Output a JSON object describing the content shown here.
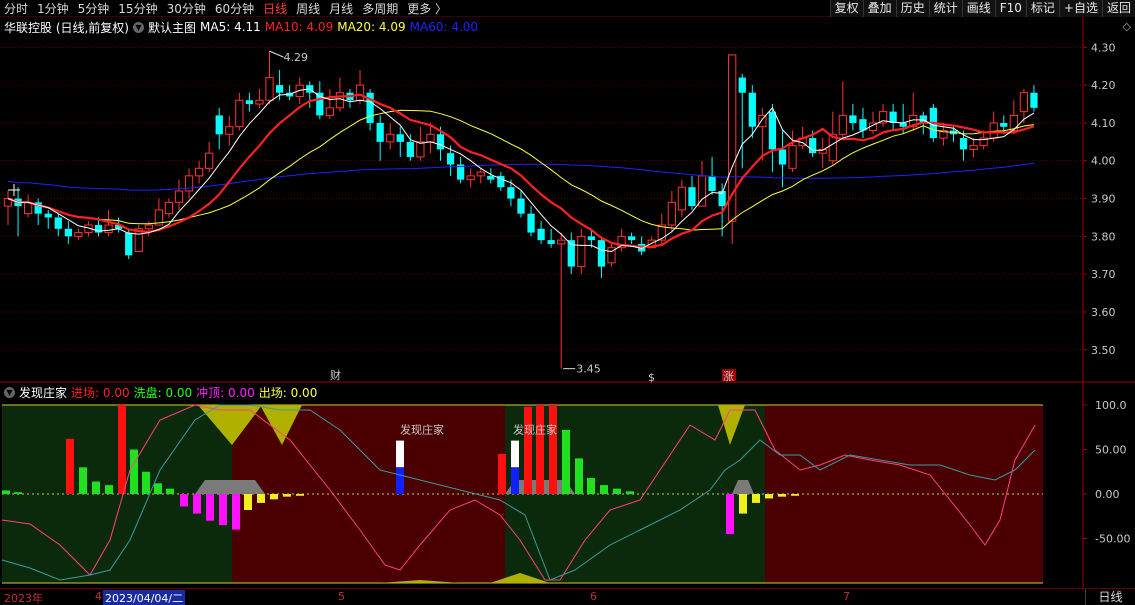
{
  "toolbar": {
    "period_tabs": [
      "分时",
      "1分钟",
      "5分钟",
      "15分钟",
      "30分钟",
      "60分钟",
      "日线",
      "周线",
      "月线",
      "多周期",
      "更多 〉"
    ],
    "active_period": "日线",
    "buttons": [
      "复权",
      "叠加",
      "历史",
      "统计",
      "画线",
      "F10",
      "标记",
      "+自选",
      "返回"
    ]
  },
  "main": {
    "title": "华联控股 (日线,前复权)",
    "template": "默认主图",
    "ma5": "MA5: 4.11",
    "ma10": "MA10: 4.09",
    "ma20": "MA20: 4.09",
    "ma60": "MA60: 4.00",
    "high_marker": "4.29",
    "low_marker": "3.45",
    "event_caiyi": "财",
    "event_s": "$",
    "event_zhang": "涨",
    "colors": {
      "up": "#ff3232",
      "down": "#00ffff",
      "ma5": "#ffffff",
      "ma10": "#ff2020",
      "ma20": "#ffff40",
      "ma60": "#2020ff"
    }
  },
  "sub": {
    "title": "发现庄家",
    "jinchang": "进场: 0.00",
    "xipan": "洗盘: 0.00",
    "chongding": "冲顶: 0.00",
    "chuchang": "出场: 0.00",
    "annotation1": "发现庄家",
    "annotation2": "发现庄家"
  },
  "bottom": {
    "dates": [
      "2023年",
      "4",
      "2023/04/04/二",
      "5",
      "6",
      "7"
    ],
    "period": "日线"
  },
  "chart_data": {
    "type": "candlestick",
    "y_ticks": [
      "4.30",
      "4.20",
      "4.10",
      "4.00",
      "3.90",
      "3.80",
      "3.70",
      "3.60",
      "3.50"
    ],
    "ylim": [
      3.42,
      4.33
    ],
    "sub_y_ticks": [
      "100.0",
      "50.00",
      "0.00",
      "-50.00"
    ],
    "sub_ylim": [
      -100,
      100
    ],
    "candles": [
      [
        3.88,
        3.9,
        3.92,
        3.83
      ],
      [
        3.9,
        3.88,
        3.93,
        3.8
      ],
      [
        3.86,
        3.89,
        3.91,
        3.85
      ],
      [
        3.89,
        3.86,
        3.9,
        3.83
      ],
      [
        3.86,
        3.85,
        3.87,
        3.82
      ],
      [
        3.85,
        3.82,
        3.86,
        3.8
      ],
      [
        3.82,
        3.8,
        3.84,
        3.78
      ],
      [
        3.8,
        3.81,
        3.82,
        3.79
      ],
      [
        3.81,
        3.83,
        3.84,
        3.8
      ],
      [
        3.83,
        3.81,
        3.85,
        3.8
      ],
      [
        3.81,
        3.83,
        3.87,
        3.8
      ],
      [
        3.83,
        3.82,
        3.85,
        3.81
      ],
      [
        3.81,
        3.75,
        3.82,
        3.74
      ],
      [
        3.76,
        3.82,
        3.83,
        3.76
      ],
      [
        3.82,
        3.83,
        3.84,
        3.8
      ],
      [
        3.83,
        3.87,
        3.9,
        3.83
      ],
      [
        3.86,
        3.89,
        3.9,
        3.85
      ],
      [
        3.89,
        3.92,
        3.95,
        3.87
      ],
      [
        3.92,
        3.96,
        3.98,
        3.9
      ],
      [
        3.96,
        3.98,
        4.0,
        3.94
      ],
      [
        3.98,
        4.02,
        4.05,
        3.97
      ],
      [
        4.12,
        4.07,
        4.14,
        4.03
      ],
      [
        4.07,
        4.09,
        4.12,
        4.04
      ],
      [
        4.09,
        4.16,
        4.18,
        4.08
      ],
      [
        4.16,
        4.15,
        4.18,
        4.13
      ],
      [
        4.15,
        4.16,
        4.19,
        4.14
      ],
      [
        4.16,
        4.22,
        4.29,
        4.15
      ],
      [
        4.2,
        4.18,
        4.24,
        4.16
      ],
      [
        4.18,
        4.17,
        4.2,
        4.16
      ],
      [
        4.17,
        4.2,
        4.22,
        4.15
      ],
      [
        4.2,
        4.18,
        4.21,
        4.14
      ],
      [
        4.18,
        4.12,
        4.21,
        4.11
      ],
      [
        4.12,
        4.14,
        4.19,
        4.11
      ],
      [
        4.14,
        4.18,
        4.22,
        4.13
      ],
      [
        4.18,
        4.16,
        4.19,
        4.14
      ],
      [
        4.16,
        4.2,
        4.24,
        4.15
      ],
      [
        4.18,
        4.1,
        4.19,
        4.08
      ],
      [
        4.1,
        4.05,
        4.12,
        4.0
      ],
      [
        4.05,
        4.07,
        4.1,
        4.03
      ],
      [
        4.07,
        4.05,
        4.09,
        4.01
      ],
      [
        4.05,
        4.01,
        4.07,
        4.0
      ],
      [
        4.01,
        4.05,
        4.09,
        4.0
      ],
      [
        4.05,
        4.07,
        4.1,
        4.02
      ],
      [
        4.07,
        4.03,
        4.09,
        4.0
      ],
      [
        4.02,
        3.99,
        4.04,
        3.96
      ],
      [
        3.99,
        3.95,
        4.01,
        3.94
      ],
      [
        3.95,
        3.96,
        3.98,
        3.93
      ],
      [
        3.96,
        3.97,
        3.98,
        3.94
      ],
      [
        3.96,
        3.95,
        3.98,
        3.94
      ],
      [
        3.96,
        3.93,
        3.97,
        3.92
      ],
      [
        3.93,
        3.9,
        3.95,
        3.88
      ],
      [
        3.9,
        3.86,
        3.92,
        3.85
      ],
      [
        3.86,
        3.81,
        3.88,
        3.8
      ],
      [
        3.82,
        3.79,
        3.84,
        3.78
      ],
      [
        3.79,
        3.78,
        3.82,
        3.77
      ],
      [
        3.78,
        3.79,
        3.81,
        3.45
      ],
      [
        3.79,
        3.72,
        3.81,
        3.7
      ],
      [
        3.72,
        3.8,
        3.82,
        3.7
      ],
      [
        3.8,
        3.79,
        3.82,
        3.77
      ],
      [
        3.79,
        3.72,
        3.8,
        3.69
      ],
      [
        3.73,
        3.77,
        3.78,
        3.72
      ],
      [
        3.77,
        3.8,
        3.82,
        3.76
      ],
      [
        3.8,
        3.79,
        3.81,
        3.78
      ],
      [
        3.78,
        3.76,
        3.8,
        3.75
      ],
      [
        3.77,
        3.79,
        3.8,
        3.77
      ],
      [
        3.79,
        3.83,
        3.86,
        3.78
      ],
      [
        3.83,
        3.89,
        3.92,
        3.81
      ],
      [
        3.87,
        3.93,
        3.95,
        3.85
      ],
      [
        3.93,
        3.88,
        3.96,
        3.87
      ],
      [
        3.88,
        3.96,
        4.0,
        3.88
      ],
      [
        3.96,
        3.92,
        4.01,
        3.91
      ],
      [
        3.92,
        3.88,
        3.94,
        3.8
      ],
      [
        3.84,
        4.28,
        4.28,
        3.78
      ],
      [
        4.22,
        4.18,
        4.23,
        3.98
      ],
      [
        4.18,
        4.09,
        4.2,
        4.06
      ],
      [
        4.09,
        4.12,
        4.14,
        4.0
      ],
      [
        4.13,
        4.03,
        4.15,
        3.97
      ],
      [
        4.03,
        3.99,
        4.08,
        3.93
      ],
      [
        3.98,
        4.04,
        4.08,
        3.97
      ],
      [
        4.04,
        4.06,
        4.09,
        4.03
      ],
      [
        4.06,
        4.02,
        4.08,
        4.01
      ],
      [
        4.02,
        4.03,
        4.06,
        3.98
      ],
      [
        4.0,
        4.07,
        4.13,
        3.99
      ],
      [
        4.07,
        4.12,
        4.21,
        4.06
      ],
      [
        4.12,
        4.1,
        4.15,
        4.08
      ],
      [
        4.11,
        4.08,
        4.14,
        4.06
      ],
      [
        4.08,
        4.1,
        4.13,
        4.07
      ],
      [
        4.1,
        4.13,
        4.15,
        4.09
      ],
      [
        4.13,
        4.1,
        4.15,
        4.08
      ],
      [
        4.1,
        4.09,
        4.15,
        4.07
      ],
      [
        4.09,
        4.12,
        4.18,
        4.08
      ],
      [
        4.12,
        4.1,
        4.13,
        4.07
      ],
      [
        4.14,
        4.06,
        4.15,
        4.05
      ],
      [
        4.06,
        4.08,
        4.1,
        4.04
      ],
      [
        4.08,
        4.07,
        4.09,
        4.05
      ],
      [
        4.06,
        4.03,
        4.08,
        4.0
      ],
      [
        4.03,
        4.04,
        4.06,
        4.01
      ],
      [
        4.04,
        4.06,
        4.08,
        4.03
      ],
      [
        4.06,
        4.1,
        4.13,
        4.05
      ],
      [
        4.1,
        4.09,
        4.12,
        4.07
      ],
      [
        4.08,
        4.12,
        4.16,
        4.07
      ],
      [
        4.13,
        4.18,
        4.19,
        4.1
      ],
      [
        4.18,
        4.14,
        4.2,
        4.13
      ]
    ]
  }
}
